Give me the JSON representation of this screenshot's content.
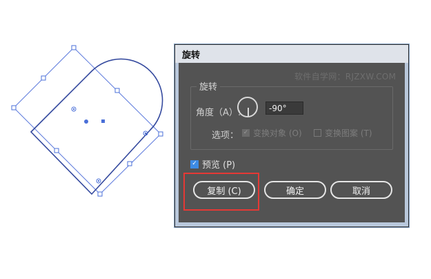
{
  "dialog": {
    "title": "旋转",
    "watermark": "软件自学网：RJZXW.COM",
    "group_title": "旋转",
    "angle_label": "角度（A）:",
    "angle_value": "-90°",
    "options_label": "选项：",
    "options": [
      {
        "label": "变换对象 (O)",
        "checked": true,
        "enabled": false
      },
      {
        "label": "变换图案 (T)",
        "checked": false,
        "enabled": false
      }
    ],
    "preview_label": "预览 (P)",
    "preview_checked": true,
    "buttons": {
      "copy": "复制 (C)",
      "ok": "确定",
      "cancel": "取消"
    }
  },
  "colors": {
    "dialog_bg": "#535353",
    "shape_stroke": "#3f5bb5",
    "bbox_stroke": "#4a6fd8",
    "highlight": "#e53935",
    "checkbox_accent": "#3d8be4"
  }
}
